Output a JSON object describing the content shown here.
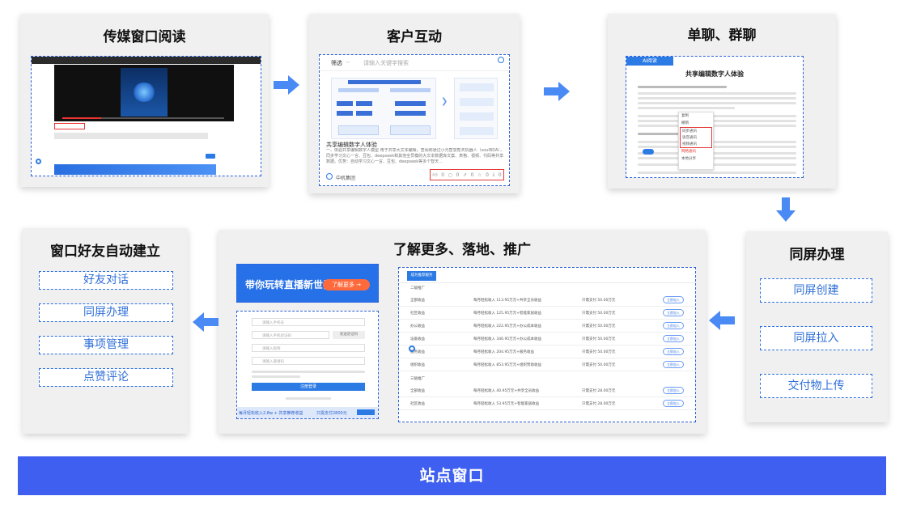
{
  "panels": {
    "media_reading": {
      "title": "传媒窗口阅读"
    },
    "customer_interaction": {
      "title": "客户互动",
      "filter_label": "筛选",
      "search_placeholder": "请输入关键字搜索",
      "card_title": "共享编辑数字人体验",
      "card_text": "一、体验共享编辑数字人模型 用于共享大文本编辑，查阅和通过小元智慧帮天机器人（soulBDA），同步学习文心一言、豆包、deepseek和其他全员模的大文本数据库文案、表格、视频、代码等共享数据。优势：自动学习文心一言、豆包、deepseek等多个智天...",
      "author": "中机集团",
      "stats": [
        "0",
        "0",
        "0",
        "0",
        "0"
      ]
    },
    "chat": {
      "title": "单聊、群聊",
      "doc_tab": "AI阅读",
      "doc_heading": "共享编辑数字人体验",
      "menu_items": [
        "复制",
        "撤销",
        "同步通讯",
        "语音通讯",
        "视频通讯",
        "网络通讯",
        "本地分享"
      ]
    },
    "same_screen": {
      "title": "同屏办理",
      "items": [
        "同屏创建",
        "同屏拉入",
        "交付物上传"
      ]
    },
    "learn_more": {
      "title": "了解更多、落地、推广",
      "banner_text": "带你玩转直播新世界",
      "banner_button": "了解更多 →",
      "form_placeholders": [
        "请输入手机号",
        "请输入手机验证码",
        "请输入昵称",
        "请输入邀请码"
      ],
      "code_button": "发送验证码",
      "login_button": "注册登录",
      "bottom_text": "每月轻松收入2.8w + 共享推荐收益",
      "bottom_pay": "只需支付2800元",
      "table_tab": "成为推荐服务",
      "group1_label": "二级推广",
      "group2_label": "三级推广",
      "rows": [
        [
          "全部收益",
          "每月轻松收入 113.95万元+共享全员收益",
          "只需支付 50.00万元",
          "立即加入"
        ],
        [
          "社区收益",
          "每月轻松收入 125.95万元+智能家居收益",
          "只需支付 50.00万元",
          "立即加入"
        ],
        [
          "办公收益",
          "每月轻松收入 222.95万元+办公成本收益",
          "只需支付 50.00万元",
          "立即加入"
        ],
        [
          "设备收益",
          "每月轻松收入 346.95万元+办公成本收益",
          "只需支付 50.00万元",
          "立即加入"
        ],
        [
          "服务收益",
          "每月轻松收入 204.95万元+服务收益",
          "只需支付 50.00万元",
          "立即加入"
        ],
        [
          "组织收益",
          "每月轻松收入 853.95万元+组织赞助收益",
          "只需支付 50.00万元",
          "立即加入"
        ],
        [
          "全部收益",
          "每月轻松收入 40.95万元+共享全员收益",
          "只需支付 28.00万元",
          "立即加入"
        ],
        [
          "社区收益",
          "每月轻松收入 53.95万元+智能家居收益",
          "只需支付 28.00万元",
          "立即加入"
        ]
      ]
    },
    "friends": {
      "title": "窗口好友自动建立",
      "items": [
        "好友对话",
        "同屏办理",
        "事项管理",
        "点赞评论"
      ]
    }
  },
  "footer": {
    "label": "站点窗口"
  },
  "colors": {
    "accent": "#3e5ff0",
    "arrow": "#4a8af4",
    "dash": "#2b6fe0"
  }
}
